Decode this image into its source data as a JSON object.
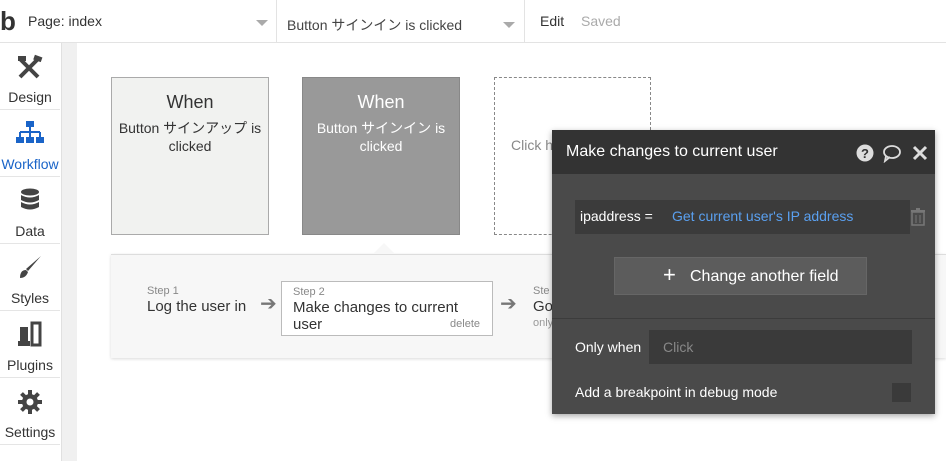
{
  "topbar": {
    "page_label": "Page: index",
    "workflow_label": "Button サインイン is clicked",
    "edit_label": "Edit",
    "saved_label": "Saved"
  },
  "sidebar": {
    "items": [
      {
        "label": "Design",
        "icon": "design-icon"
      },
      {
        "label": "Workflow",
        "icon": "workflow-icon"
      },
      {
        "label": "Data",
        "icon": "database-icon"
      },
      {
        "label": "Styles",
        "icon": "brush-icon"
      },
      {
        "label": "Plugins",
        "icon": "plugin-icon"
      },
      {
        "label": "Settings",
        "icon": "gear-icon"
      }
    ]
  },
  "events": [
    {
      "heading": "When",
      "text": "Button サインアップ is clicked"
    },
    {
      "heading": "When",
      "text": "Button サインイン is clicked"
    },
    {
      "text": "Click h"
    }
  ],
  "steps": [
    {
      "num": "Step 1",
      "label": "Log the user in"
    },
    {
      "num": "Step 2",
      "label": "Make changes to current user",
      "delete": "delete"
    },
    {
      "num": "Ste",
      "label": "Go",
      "only": "only"
    }
  ],
  "panel": {
    "title": "Make changes to current user",
    "field_key": "ipaddress =",
    "field_value": "Get current user's IP address",
    "change_button": "Change another field",
    "only_when_label": "Only when",
    "only_when_placeholder": "Click",
    "breakpoint_label": "Add a breakpoint in debug mode"
  },
  "colors": {
    "accent": "#1a64c8",
    "link": "#5aa0f0",
    "panel_bg": "#4a4a4a"
  }
}
